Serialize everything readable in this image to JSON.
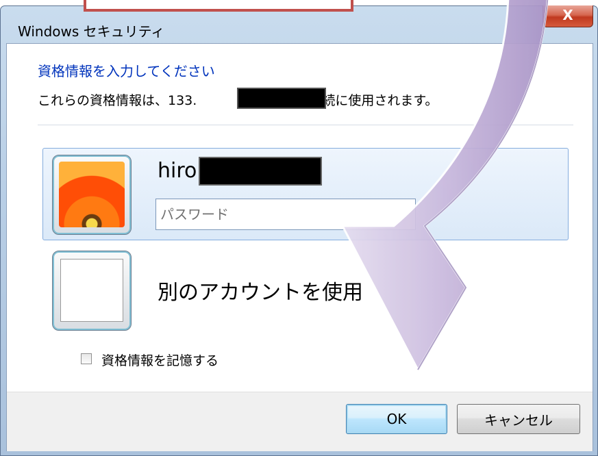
{
  "window": {
    "title": "Windows セキュリティ",
    "close_label": "X"
  },
  "dialog": {
    "heading": "資格情報を入力してください",
    "description": "これらの資格情報は、133.",
    "description_tail": "への接続に使用されます。"
  },
  "account": {
    "username_prefix": "hiro",
    "password_placeholder": "パスワード"
  },
  "other_account": {
    "label": "別のアカウントを使用"
  },
  "remember": {
    "label": "資格情報を記憶する",
    "checked": false
  },
  "buttons": {
    "ok": "OK",
    "cancel": "キャンセル"
  },
  "colors": {
    "heading": "#0033bc",
    "overlay_arrow": "#c9b9dd",
    "highlight_box": "#c0504d"
  }
}
